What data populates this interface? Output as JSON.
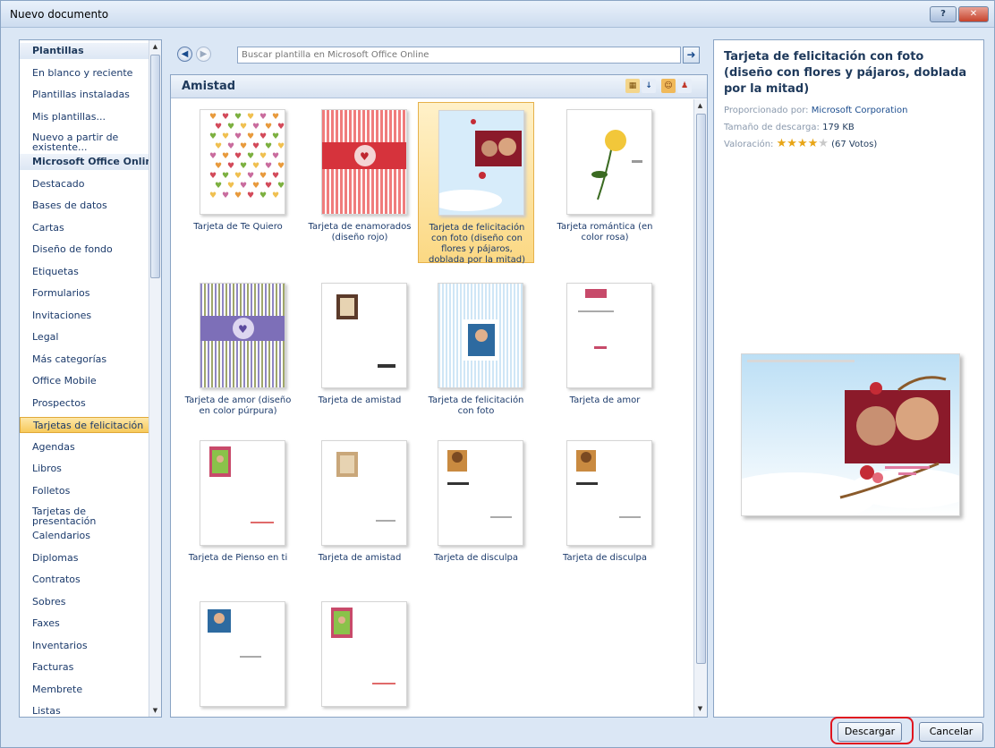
{
  "window": {
    "title": "Nuevo documento"
  },
  "colors": {
    "accent_selection": "#fbd883",
    "highlight_ring": "#e0141f",
    "frame": "#dbe7f5"
  },
  "sidebar": {
    "items": [
      {
        "label": "Plantillas",
        "kind": "header"
      },
      {
        "label": "En blanco y reciente"
      },
      {
        "label": "Plantillas instaladas"
      },
      {
        "label": "Mis plantillas..."
      },
      {
        "label": "Nuevo a partir de existente...",
        "line1": "Nuevo a partir de",
        "line2": "existente..."
      },
      {
        "label": "Microsoft Office Online",
        "kind": "header"
      },
      {
        "label": "Destacado"
      },
      {
        "label": "Bases de datos"
      },
      {
        "label": "Cartas"
      },
      {
        "label": "Diseño de fondo"
      },
      {
        "label": "Etiquetas"
      },
      {
        "label": "Formularios"
      },
      {
        "label": "Invitaciones"
      },
      {
        "label": "Legal"
      },
      {
        "label": "Más categorías"
      },
      {
        "label": "Office Mobile"
      },
      {
        "label": "Prospectos"
      },
      {
        "label": "Tarjetas de felicitación",
        "selected": true
      },
      {
        "label": "Agendas"
      },
      {
        "label": "Libros"
      },
      {
        "label": "Folletos"
      },
      {
        "label": "Tarjetas de presentación",
        "line1": "Tarjetas de",
        "line2": "presentación"
      },
      {
        "label": "Calendarios"
      },
      {
        "label": "Diplomas"
      },
      {
        "label": "Contratos"
      },
      {
        "label": "Sobres"
      },
      {
        "label": "Faxes"
      },
      {
        "label": "Inventarios"
      },
      {
        "label": "Facturas"
      },
      {
        "label": "Membrete"
      },
      {
        "label": "Listas"
      }
    ]
  },
  "search": {
    "placeholder": "Buscar plantilla en Microsoft Office Online"
  },
  "gallery": {
    "title": "Amistad",
    "templates": [
      {
        "l1": "Tarjeta de Te Quiero",
        "l2": "",
        "l3": "",
        "l4": "",
        "l5": ""
      },
      {
        "l1": "Tarjeta de enamorados",
        "l2": "(diseño rojo)",
        "l3": "",
        "l4": "",
        "l5": ""
      },
      {
        "l1": "Tarjeta de felicitación",
        "l2": "con foto (diseño con",
        "l3": "flores y pájaros,",
        "l4": "doblada por la mitad)",
        "l5": "",
        "selected": true
      },
      {
        "l1": "Tarjeta romántica (en",
        "l2": "color rosa)",
        "l3": "",
        "l4": "",
        "l5": ""
      },
      {
        "l1": "Tarjeta de amor (diseño",
        "l2": "en color púrpura)",
        "l3": "",
        "l4": "",
        "l5": ""
      },
      {
        "l1": "Tarjeta de amistad",
        "l2": "",
        "l3": "",
        "l4": "",
        "l5": ""
      },
      {
        "l1": "Tarjeta de felicitación",
        "l2": "con foto",
        "l3": "",
        "l4": "",
        "l5": ""
      },
      {
        "l1": "Tarjeta de amor",
        "l2": "",
        "l3": "",
        "l4": "",
        "l5": ""
      },
      {
        "l1": "Tarjeta de Pienso en ti",
        "l2": "",
        "l3": "",
        "l4": "",
        "l5": ""
      },
      {
        "l1": "Tarjeta de amistad",
        "l2": "",
        "l3": "",
        "l4": "",
        "l5": ""
      },
      {
        "l1": "Tarjeta de disculpa",
        "l2": "",
        "l3": "",
        "l4": "",
        "l5": ""
      },
      {
        "l1": "Tarjeta de disculpa",
        "l2": "",
        "l3": "",
        "l4": "",
        "l5": ""
      },
      {
        "l1": "",
        "l2": "",
        "l3": "",
        "l4": "",
        "l5": ""
      },
      {
        "l1": "",
        "l2": "",
        "l3": "",
        "l4": "",
        "l5": ""
      }
    ]
  },
  "details": {
    "title": "Tarjeta de felicitación con foto (diseño con flores y pájaros, doblada por la mitad)",
    "provided_by_label": "Proporcionado por:",
    "provided_by": "Microsoft Corporation",
    "size_label": "Tamaño de descarga:",
    "size": "179 KB",
    "rating_label": "Valoración:",
    "rating_stars": 4,
    "votes": "(67 Votos)"
  },
  "buttons": {
    "download": "Descargar",
    "cancel": "Cancelar"
  }
}
